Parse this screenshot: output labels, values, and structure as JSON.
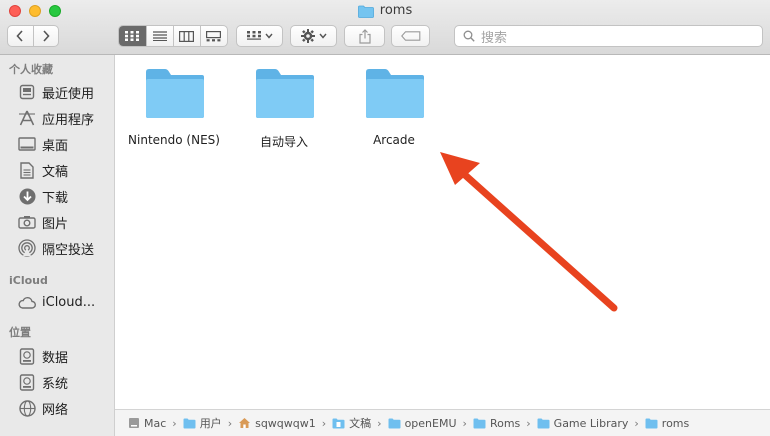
{
  "window": {
    "title": "roms"
  },
  "toolbar": {
    "search_placeholder": "搜索"
  },
  "sidebar": {
    "sections": [
      {
        "title": "个人收藏",
        "items": [
          {
            "label": "最近使用",
            "icon": "recents-icon"
          },
          {
            "label": "应用程序",
            "icon": "applications-icon"
          },
          {
            "label": "桌面",
            "icon": "desktop-icon"
          },
          {
            "label": "文稿",
            "icon": "documents-icon"
          },
          {
            "label": "下载",
            "icon": "downloads-icon"
          },
          {
            "label": "图片",
            "icon": "pictures-icon"
          },
          {
            "label": "隔空投送",
            "icon": "airdrop-icon"
          }
        ]
      },
      {
        "title": "iCloud",
        "items": [
          {
            "label": "iCloud...",
            "icon": "icloud-icon"
          }
        ]
      },
      {
        "title": "位置",
        "items": [
          {
            "label": "数据",
            "icon": "disk-icon"
          },
          {
            "label": "系统",
            "icon": "disk-icon"
          },
          {
            "label": "网络",
            "icon": "network-icon"
          }
        ]
      }
    ]
  },
  "files": [
    {
      "name": "Nintendo (NES)"
    },
    {
      "name": "自动导入"
    },
    {
      "name": "Arcade"
    }
  ],
  "pathbar": [
    {
      "label": "Mac",
      "icon": "disk-icon"
    },
    {
      "label": "用户",
      "icon": "folder-icon"
    },
    {
      "label": "sqwqwqw1",
      "icon": "home-icon"
    },
    {
      "label": "文稿",
      "icon": "documents-folder-icon"
    },
    {
      "label": "openEMU",
      "icon": "folder-icon"
    },
    {
      "label": "Roms",
      "icon": "folder-icon"
    },
    {
      "label": "Game Library",
      "icon": "folder-icon"
    },
    {
      "label": "roms",
      "icon": "folder-icon"
    }
  ],
  "colors": {
    "folder": "#6cc3f2",
    "annotation_arrow": "#e8431f"
  }
}
